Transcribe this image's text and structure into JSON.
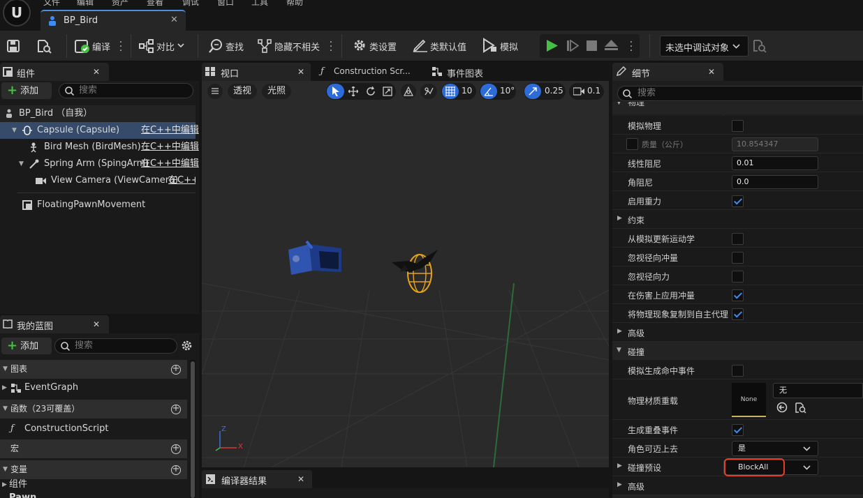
{
  "menu": [
    "文件",
    "编辑",
    "资产",
    "查看",
    "调试",
    "窗口",
    "工具",
    "帮助"
  ],
  "document_tab": {
    "title": "BP_Bird"
  },
  "toolbar": {
    "compile": "编译",
    "diff": "对比",
    "find": "查找",
    "hide_unrelated": "隐藏不相关",
    "class_settings": "类设置",
    "class_defaults": "类默认值",
    "simulate": "模拟",
    "debug_target": "未选中调试对象"
  },
  "components_panel": {
    "title": "组件",
    "add_label": "添加",
    "search_placeholder": "搜索",
    "items": [
      {
        "name": "BP_Bird （自我）",
        "link": ""
      },
      {
        "name": "Capsule (Capsule)",
        "link": "在C++中编辑"
      },
      {
        "name": "Bird Mesh (BirdMesh)",
        "link": "在C++中编辑"
      },
      {
        "name": "Spring Arm (SpingArm)",
        "link": "在C++中编辑"
      },
      {
        "name": "View Camera (ViewCamera)",
        "link": "在C++中"
      },
      {
        "name": "FloatingPawnMovement",
        "link": ""
      }
    ]
  },
  "blueprint_panel": {
    "title": "我的蓝图",
    "add_label": "添加",
    "search_placeholder": "搜索",
    "sections": {
      "graphs": "图表",
      "event_graph": "EventGraph",
      "functions": "函数（23可覆盖）",
      "construction_script": "ConstructionScript",
      "macros": "宏",
      "variables": "变量",
      "components": "组件",
      "pawn": "Pawn"
    }
  },
  "viewport": {
    "tab": "视口",
    "tab_construction": "Construction Scr...",
    "tab_event_graph": "事件图表",
    "perspective": "透视",
    "lighting": "光照",
    "grid_snap": "10",
    "rotation_snap": "10°",
    "scale_snap": "0.25",
    "camera_speed": "0.1",
    "axis_x": "X",
    "axis_z": "Z"
  },
  "compiler_results": {
    "title": "编译器结果"
  },
  "details": {
    "title": "细节",
    "search_placeholder": "搜索",
    "partial_header": "物理",
    "rows": {
      "simulate_physics": "模拟物理",
      "mass": "质量（公斤）",
      "mass_value": "10.854347",
      "linear_damping": "线性阻尼",
      "linear_damping_value": "0.01",
      "angular_damping": "角阻尼",
      "angular_damping_value": "0.0",
      "enable_gravity": "启用重力",
      "constraints": "约束",
      "update_kinematic": "从模拟更新运动学",
      "ignore_radial_impulse": "忽视径向冲量",
      "ignore_radial_force": "忽视径向力",
      "apply_impulse_on_damage": "在伤害上应用冲量",
      "replicate_physics": "将物理现象复制到自主代理",
      "advanced_1": "高级",
      "collision": "碰撞",
      "simulation_hit_events": "模拟生成命中事件",
      "phys_material_override": "物理材质重载",
      "material_thumb": "None",
      "material_value": "无",
      "generate_overlap_events": "生成重叠事件",
      "can_step_up_on": "角色可迈上去",
      "can_step_up_value": "是",
      "collision_presets": "碰撞预设",
      "collision_presets_value": "BlockAll",
      "advanced_2": "高级"
    }
  },
  "colors": {
    "accent_blue": "#2d6bd8",
    "play_green": "#44c144",
    "highlight_red": "#e0402a"
  }
}
